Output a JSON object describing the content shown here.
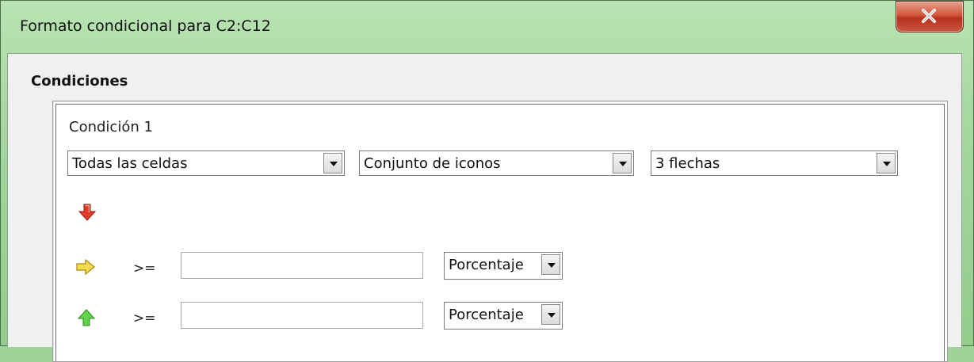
{
  "window": {
    "title": "Formato condicional para C2:C12"
  },
  "section": {
    "title": "Condiciones"
  },
  "condition": {
    "label": "Condición 1",
    "apply_to": "Todas las celdas",
    "type": "Conjunto de iconos",
    "icon_set": "3 flechas"
  },
  "rows": [
    {
      "icon": "red-down-arrow-icon",
      "color": "#e02020"
    },
    {
      "icon": "yellow-right-arrow-icon",
      "color": "#f2d23a",
      "operator": ">=",
      "value": "",
      "unit": "Porcentaje"
    },
    {
      "icon": "green-up-arrow-icon",
      "color": "#5fcf4a",
      "operator": ">=",
      "value": "",
      "unit": "Porcentaje"
    }
  ]
}
